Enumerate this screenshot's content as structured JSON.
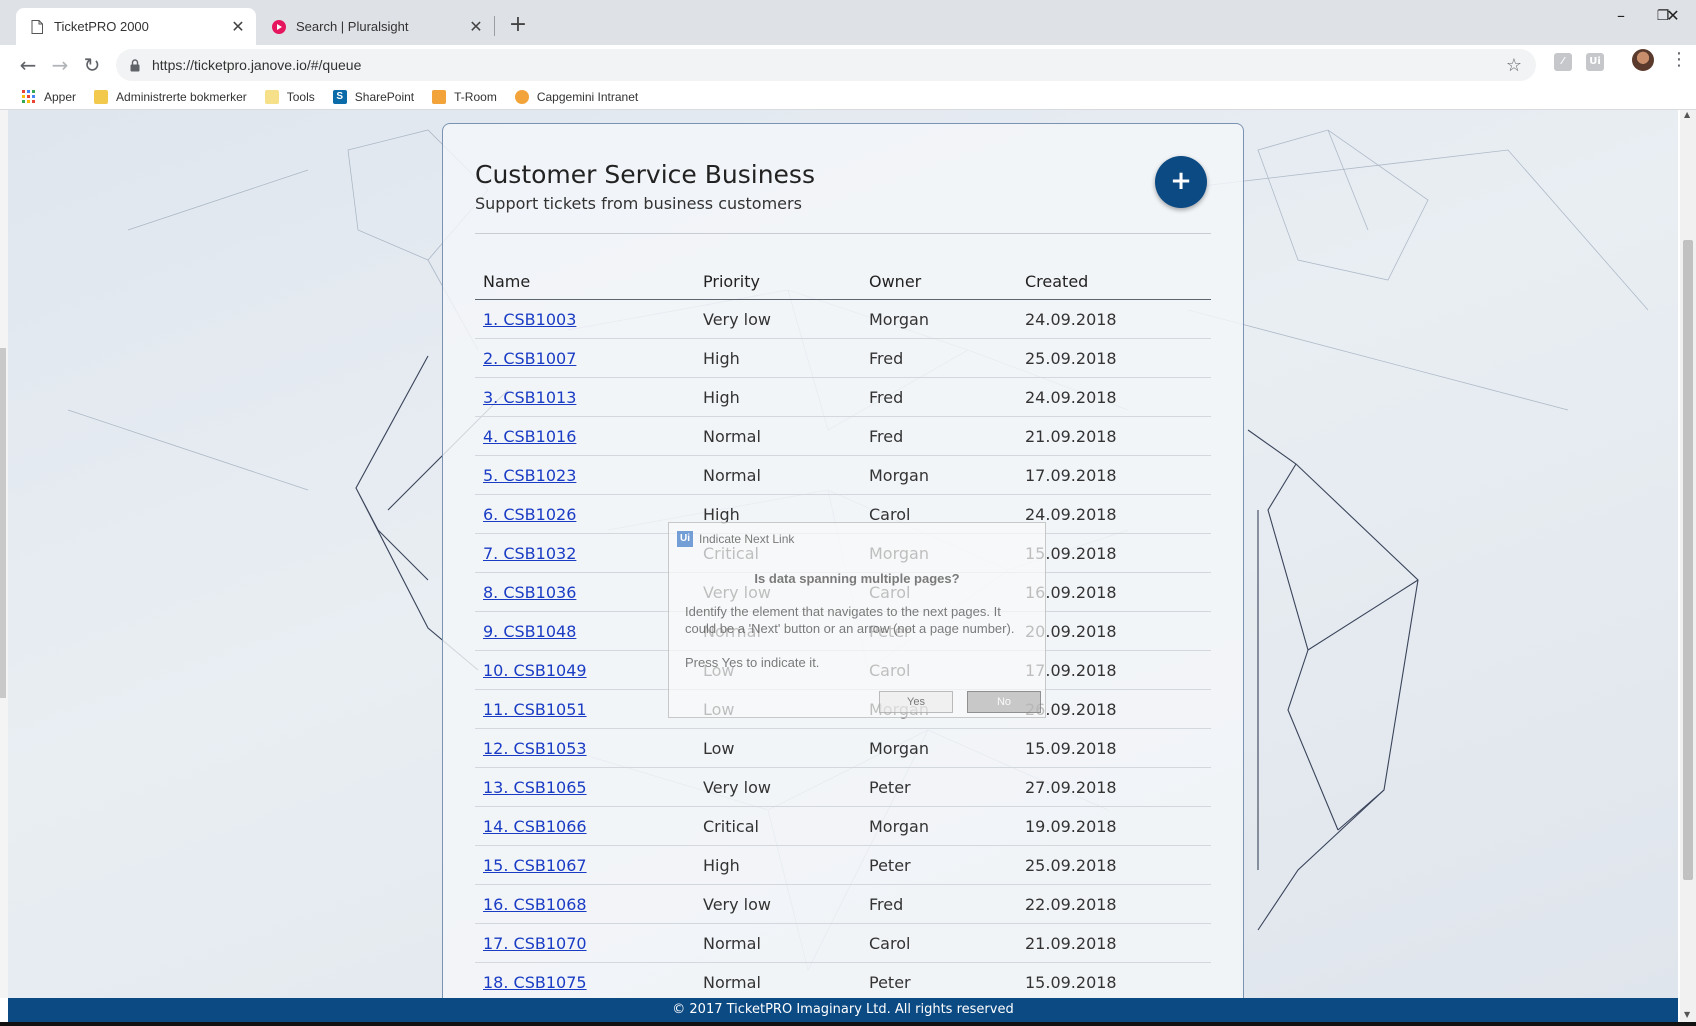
{
  "browser": {
    "tabs": [
      {
        "title": "TicketPRO 2000",
        "icon": "page-icon",
        "active": true
      },
      {
        "title": "Search | Pluralsight",
        "icon": "pluralsight-icon",
        "active": false
      }
    ],
    "new_tab_label": "+",
    "window_controls": {
      "minimize": "–",
      "restore": "❐",
      "close": "✕"
    },
    "url": "https://ticketpro.janove.io/#/queue",
    "bookmarks": [
      {
        "label": "Apper",
        "icon": "apps-grid-icon",
        "color": "#ea4335"
      },
      {
        "label": "Administrerte bokmerker",
        "icon": "folder-icon",
        "color": "#f2c94c"
      },
      {
        "label": "Tools",
        "icon": "folder-icon",
        "color": "#f2c94c"
      },
      {
        "label": "SharePoint",
        "icon": "sharepoint-icon",
        "color": "#0b6aa8"
      },
      {
        "label": "T-Room",
        "icon": "t-room-icon",
        "color": "#f2a33a"
      },
      {
        "label": "Capgemini Intranet",
        "icon": "capgemini-icon",
        "color": "#f2a33a"
      }
    ]
  },
  "page": {
    "title": "Customer Service Business",
    "subtitle": "Support tickets from business customers",
    "add_button_label": "+",
    "accent_color": "#0c4a84",
    "table": {
      "headers": [
        "Name",
        "Priority",
        "Owner",
        "Created"
      ],
      "rows": [
        {
          "name": "1. CSB1003",
          "priority": "Very low",
          "owner": "Morgan",
          "created": "24.09.2018"
        },
        {
          "name": "2. CSB1007",
          "priority": "High",
          "owner": "Fred",
          "created": "25.09.2018"
        },
        {
          "name": "3. CSB1013",
          "priority": "High",
          "owner": "Fred",
          "created": "24.09.2018"
        },
        {
          "name": "4. CSB1016",
          "priority": "Normal",
          "owner": "Fred",
          "created": "21.09.2018"
        },
        {
          "name": "5. CSB1023",
          "priority": "Normal",
          "owner": "Morgan",
          "created": "17.09.2018"
        },
        {
          "name": "6. CSB1026",
          "priority": "High",
          "owner": "Carol",
          "created": "24.09.2018"
        },
        {
          "name": "7. CSB1032",
          "priority": "Critical",
          "owner": "Morgan",
          "created": "15.09.2018"
        },
        {
          "name": "8. CSB1036",
          "priority": "Very low",
          "owner": "Carol",
          "created": "16.09.2018"
        },
        {
          "name": "9. CSB1048",
          "priority": "Normal",
          "owner": "Peter",
          "created": "20.09.2018"
        },
        {
          "name": "10. CSB1049",
          "priority": "Low",
          "owner": "Carol",
          "created": "17.09.2018"
        },
        {
          "name": "11. CSB1051",
          "priority": "Low",
          "owner": "Morgan",
          "created": "26.09.2018"
        },
        {
          "name": "12. CSB1053",
          "priority": "Low",
          "owner": "Morgan",
          "created": "15.09.2018"
        },
        {
          "name": "13. CSB1065",
          "priority": "Very low",
          "owner": "Peter",
          "created": "27.09.2018"
        },
        {
          "name": "14. CSB1066",
          "priority": "Critical",
          "owner": "Morgan",
          "created": "19.09.2018"
        },
        {
          "name": "15. CSB1067",
          "priority": "High",
          "owner": "Peter",
          "created": "25.09.2018"
        },
        {
          "name": "16. CSB1068",
          "priority": "Very low",
          "owner": "Fred",
          "created": "22.09.2018"
        },
        {
          "name": "17. CSB1070",
          "priority": "Normal",
          "owner": "Carol",
          "created": "21.09.2018"
        },
        {
          "name": "18. CSB1075",
          "priority": "Normal",
          "owner": "Peter",
          "created": "15.09.2018"
        }
      ]
    },
    "footer": "© 2017 TicketPRO Imaginary Ltd. All rights reserved"
  },
  "dialog": {
    "title": "Indicate Next Link",
    "logo": "Ui",
    "question": "Is data spanning multiple pages?",
    "body": "Identify the element that navigates to the next pages. It could be a 'Next' button or an arrow (not a page number).",
    "press_text": "Press Yes to indicate it.",
    "yes_label": "Yes",
    "no_label": "No"
  }
}
